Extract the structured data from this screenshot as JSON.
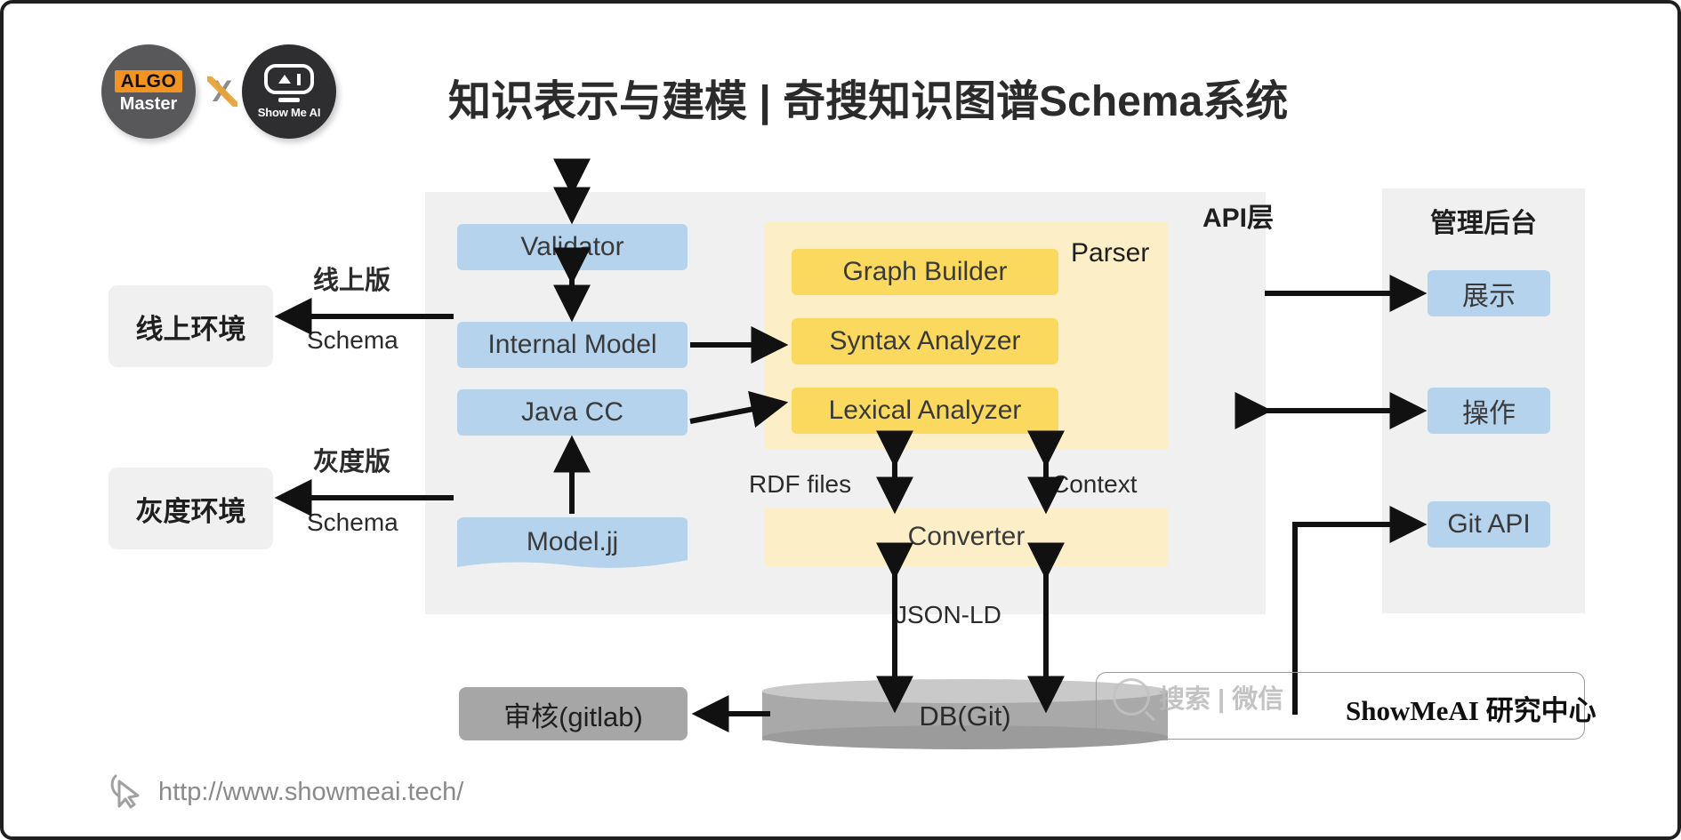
{
  "header": {
    "title": "知识表示与建模 | 奇搜知识图谱Schema系统",
    "logo_left": {
      "top_text": "ALGO",
      "bottom_text": "Master"
    },
    "logo_separator": "X",
    "logo_right": {
      "text": "Show Me AI"
    }
  },
  "panels": {
    "api_layer_label": "API层",
    "parser_label": "Parser",
    "admin_label": "管理后台"
  },
  "pipeline": {
    "validator": "Validator",
    "internal_model": "Internal Model",
    "java_cc": "Java CC",
    "model_jj": "Model.jj"
  },
  "parser": {
    "graph_builder": "Graph Builder",
    "syntax_analyzer": "Syntax Analyzer",
    "lexical_analyzer": "Lexical Analyzer",
    "converter": "Converter"
  },
  "environments": {
    "online": "线上环境",
    "gray": "灰度环境"
  },
  "edge_labels": {
    "online_version": "线上版",
    "online_schema": "Schema",
    "gray_version": "灰度版",
    "gray_schema": "Schema",
    "rdf_files": "RDF files",
    "context": "Context",
    "json_ld": "JSON-LD"
  },
  "admin": {
    "display": "展示",
    "operate": "操作",
    "git_api": "Git API"
  },
  "storage": {
    "db": "DB(Git)",
    "review": "审核(gitlab)"
  },
  "watermark": {
    "ghost_text": "搜索 | 微信",
    "brand": "ShowMeAI 研究中心"
  },
  "footer": {
    "url": "http://www.showmeai.tech/"
  },
  "colors": {
    "blue_box": "#b6d3ee",
    "yellow_box": "#fbd95f",
    "yellow_zone": "#fcefc7",
    "panel_gray": "#f0f0f0",
    "dark_gray": "#a9a9a9",
    "accent_orange": "#f39322",
    "text_dark": "#2b2b2b"
  }
}
